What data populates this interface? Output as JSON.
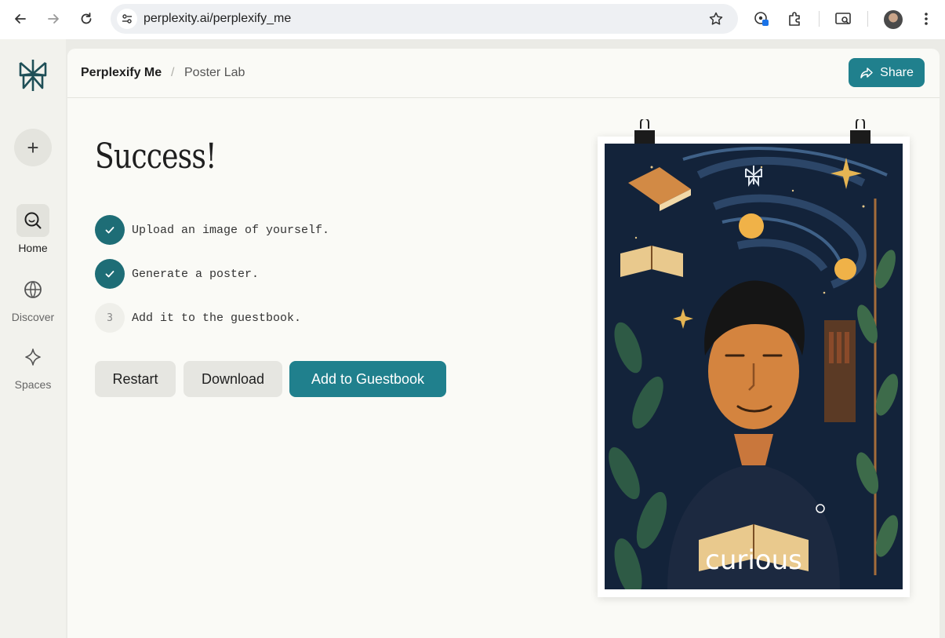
{
  "browser": {
    "url": "perplexity.ai/perplexify_me",
    "icons": [
      "back-icon",
      "forward-icon",
      "reload-icon",
      "site-settings-icon",
      "star-icon",
      "password-icon",
      "extensions-icon",
      "tab-search-icon",
      "profile-avatar",
      "menu-icon"
    ]
  },
  "rail": {
    "items": [
      {
        "label": "Home",
        "icon": "search-icon",
        "active": true
      },
      {
        "label": "Discover",
        "icon": "globe-icon"
      },
      {
        "label": "Spaces",
        "icon": "sparkle-icon"
      }
    ]
  },
  "header": {
    "crumb_app": "Perplexify Me",
    "crumb_sep": "/",
    "crumb_page": "Poster Lab",
    "share_label": "Share"
  },
  "content": {
    "title": "Success!",
    "steps": [
      {
        "text": "Upload an image of yourself.",
        "done": true
      },
      {
        "text": "Generate a poster.",
        "done": true
      },
      {
        "number": "3",
        "text": "Add it to the guestbook.",
        "done": false
      }
    ],
    "buttons": {
      "restart": "Restart",
      "download": "Download",
      "add": "Add to Guestbook"
    }
  },
  "poster": {
    "caption": "curious"
  },
  "colors": {
    "accent": "#20808d",
    "check": "#1e6d76",
    "poster_bg": "#13233a"
  }
}
